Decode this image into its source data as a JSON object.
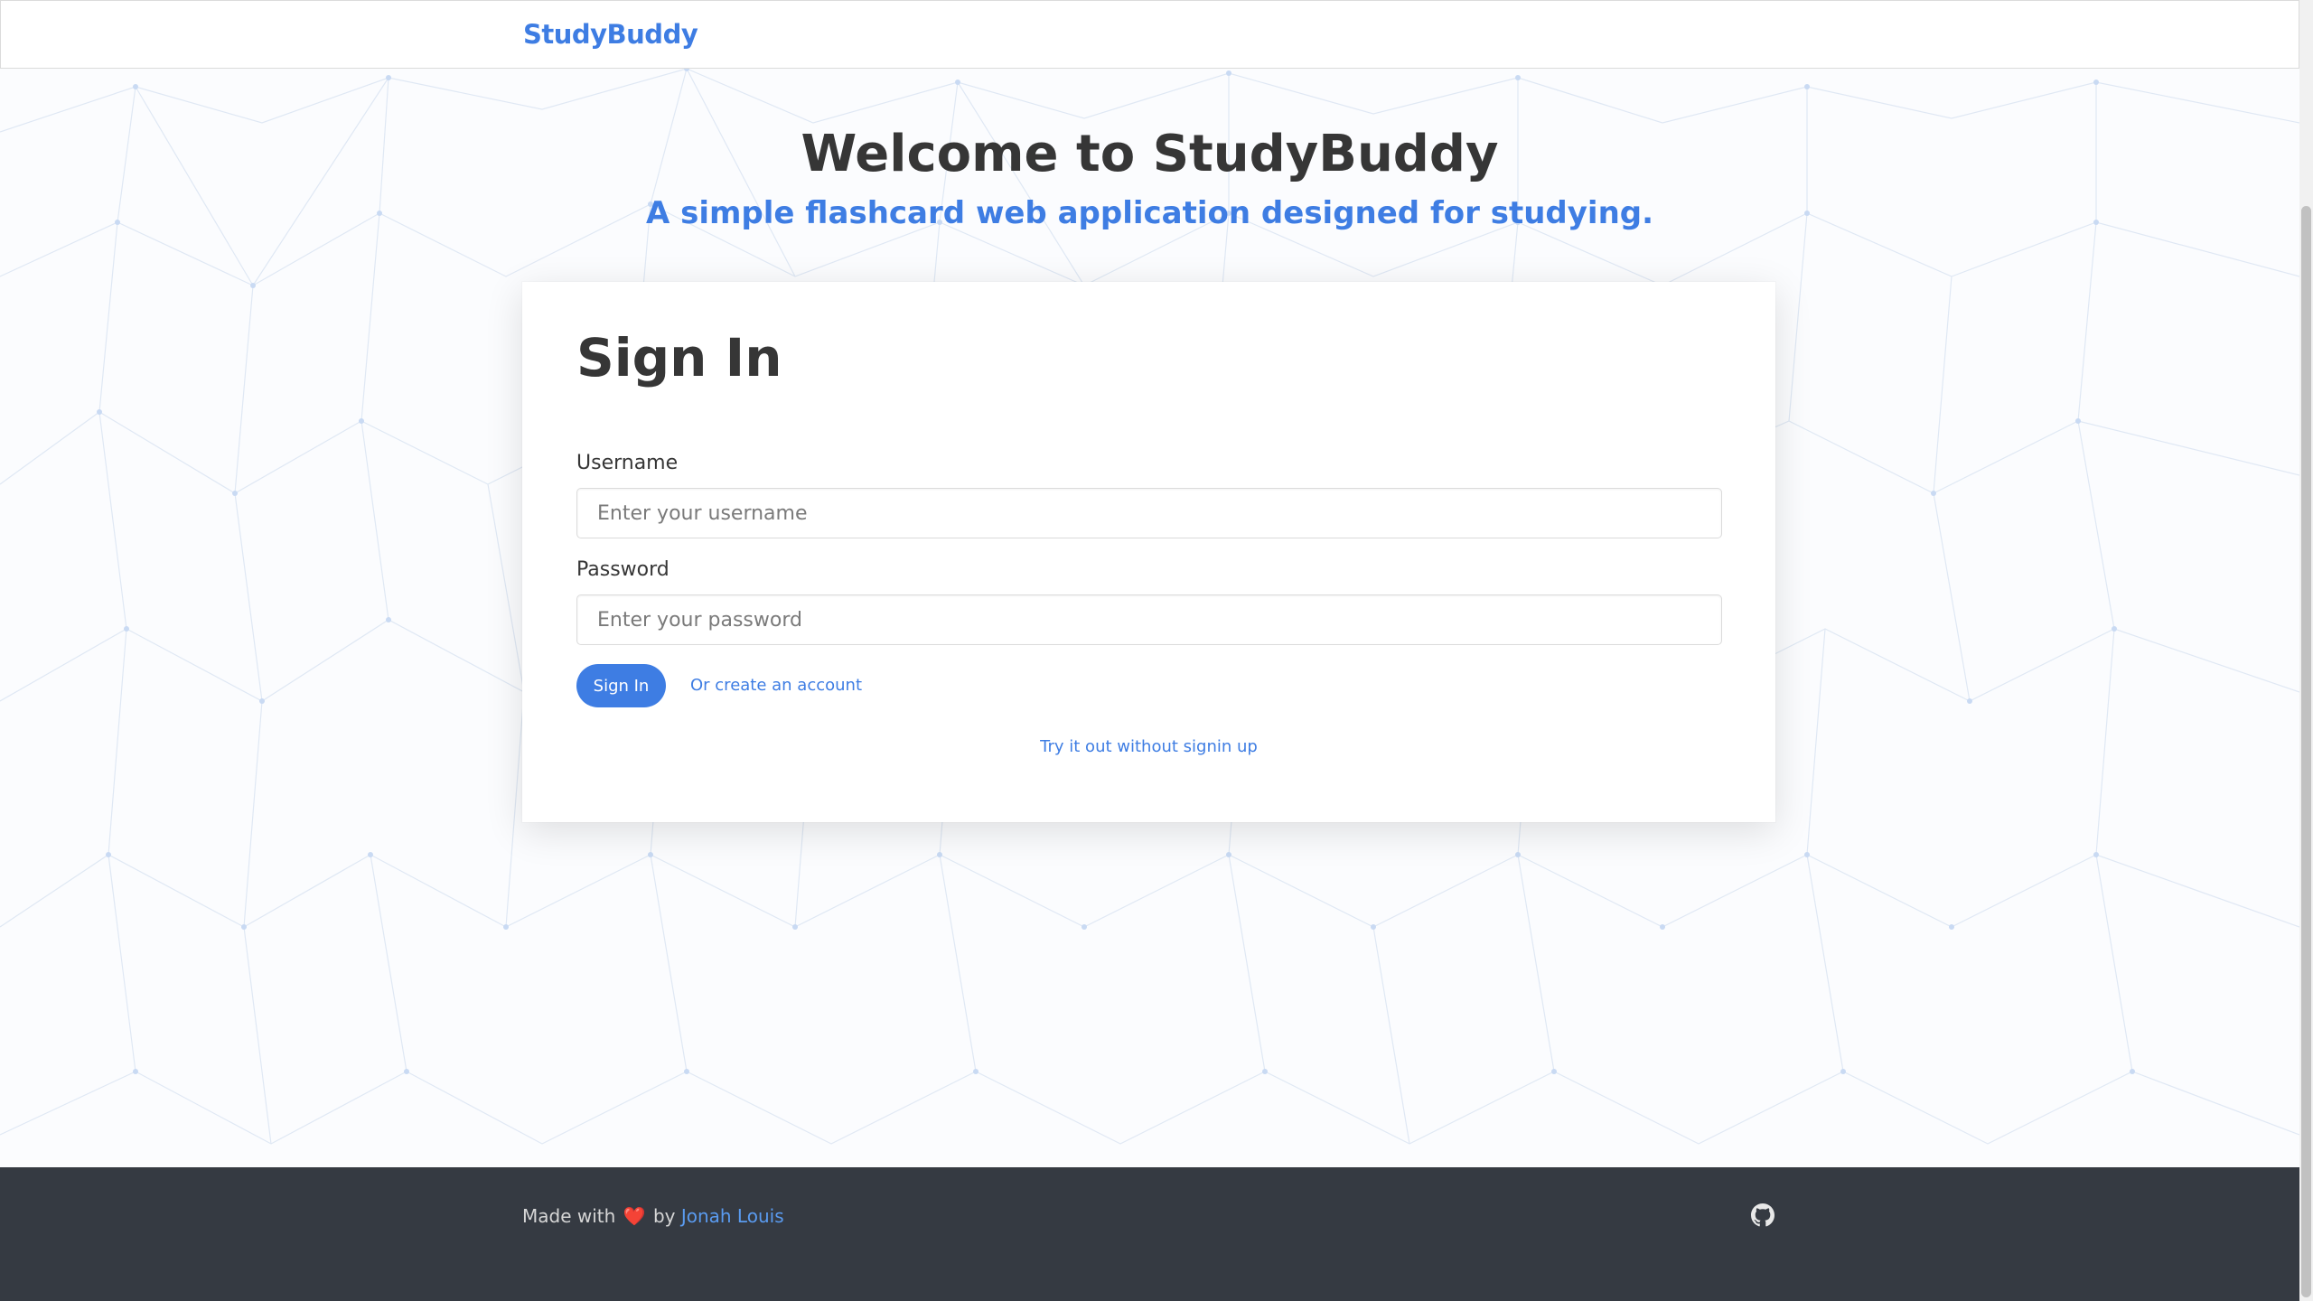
{
  "navbar": {
    "brand": "StudyBuddy"
  },
  "hero": {
    "title": "Welcome to StudyBuddy",
    "subtitle": "A simple flashcard web application designed for studying."
  },
  "signin": {
    "title": "Sign In",
    "username_label": "Username",
    "username_placeholder": "Enter your username",
    "username_value": "",
    "password_label": "Password",
    "password_placeholder": "Enter your password",
    "password_value": "",
    "submit_label": "Sign In",
    "create_account_link": "Or create an account",
    "try_without_link": "Try it out without signin up"
  },
  "footer": {
    "made_with": "Made with",
    "heart": "❤️",
    "by": "by",
    "author": "Jonah Louis",
    "github_icon": "github-icon"
  },
  "colors": {
    "accent": "#3e7de3",
    "heading": "#363636",
    "footer_bg": "#353a42",
    "heart": "#e53935"
  }
}
